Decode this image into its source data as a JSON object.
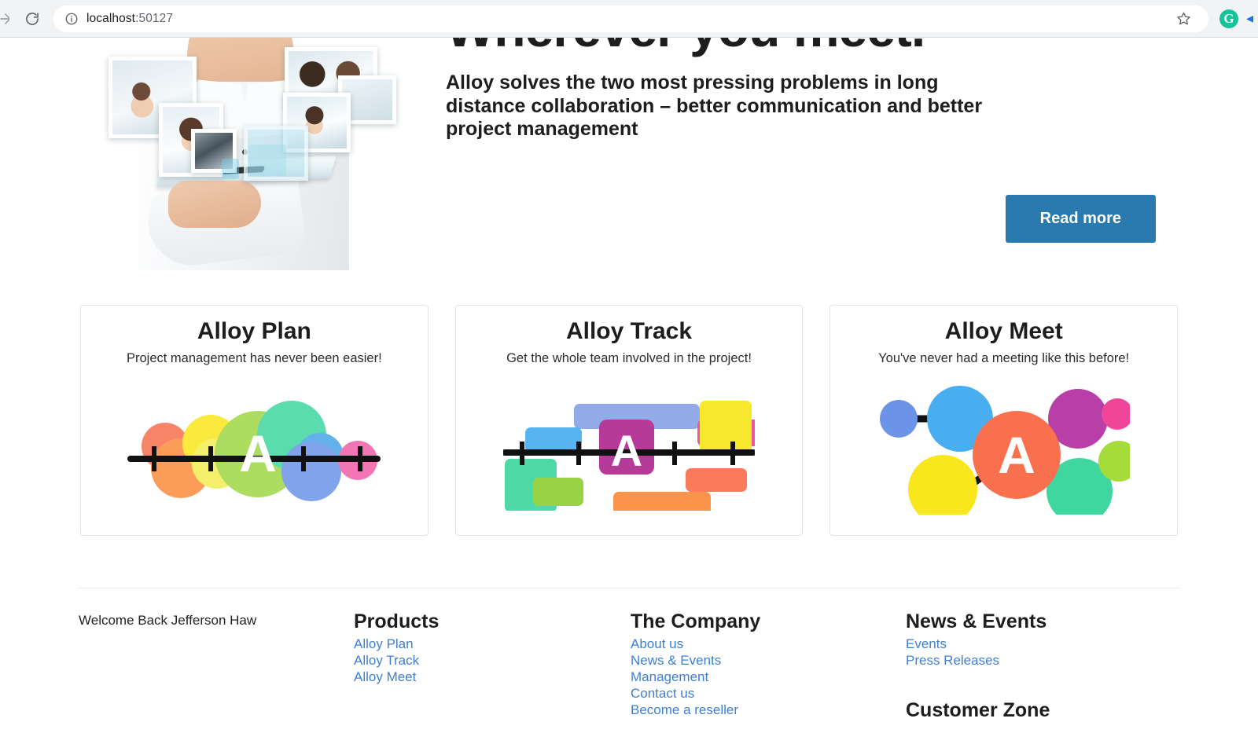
{
  "browser": {
    "url_host": "localhost",
    "url_port": ":50127",
    "back_icon": "back-arrow-icon",
    "forward_icon": "forward-arrow-icon",
    "reload_icon": "reload-icon",
    "site_info_icon": "info-circle-icon",
    "bookmark_icon": "star-icon",
    "extension_grammarly": "G",
    "extension_arrow_icon": "extensions-arrow-icon"
  },
  "hero": {
    "title": "Wherever you meet.",
    "subtitle": "Alloy solves the two most pressing problems in long distance collaboration – better communication and better project management",
    "cta_label": "Read more",
    "cta_color": "#2a7ab0",
    "image_alt": "businessman-holding-tablet-with-video-call-photos"
  },
  "products": [
    {
      "title": "Alloy Plan",
      "tagline": "Project management has never been easier!",
      "logo": "alloy-plan-timeline-logo",
      "logo_letter": "A",
      "logo_colors": [
        "#f9704f",
        "#fb8c3c",
        "#f8e71c",
        "#f4ee52",
        "#9ed645",
        "#3fd6a0",
        "#4aa3e8",
        "#6b93e8",
        "#f15fa8"
      ]
    },
    {
      "title": "Alloy Track",
      "tagline": "Get the whole team involved in the project!",
      "logo": "alloy-track-gantt-logo",
      "logo_letter": "A",
      "logo_colors": [
        "#b02a8f",
        "#8aa6e8",
        "#49aef0",
        "#3fd6a0",
        "#8fd036",
        "#f8e71c",
        "#f0469a",
        "#f9704f",
        "#fb8c3c"
      ]
    },
    {
      "title": "Alloy Meet",
      "tagline": "You've never had a meeting like this before!",
      "logo": "alloy-meet-network-logo",
      "logo_letter": "A",
      "logo_colors": [
        "#f9704f",
        "#49aef0",
        "#6b93e8",
        "#b93fa8",
        "#f0469a",
        "#f8e71c",
        "#3fd6a0",
        "#a5dc3c"
      ]
    }
  ],
  "footer": {
    "welcome": "Welcome Back Jefferson Haw",
    "link_color": "#3f7fd0",
    "columns": [
      {
        "heading": "Products",
        "links": [
          "Alloy Plan",
          "Alloy Track",
          "Alloy Meet"
        ]
      },
      {
        "heading": "The Company",
        "links": [
          "About us",
          "News & Events",
          "Management",
          "Contact us",
          "Become a reseller"
        ]
      },
      {
        "heading": "News & Events",
        "links": [
          "Events",
          "Press Releases"
        ],
        "heading2": "Customer Zone"
      }
    ]
  }
}
